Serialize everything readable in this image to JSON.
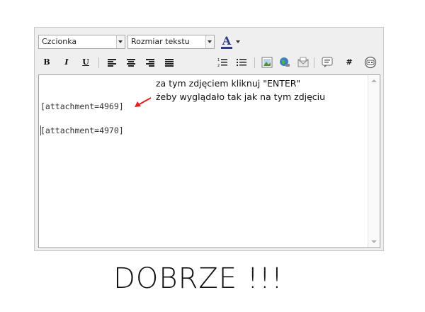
{
  "toolbar": {
    "font_select": "Czcionka",
    "size_select": "Rozmiar tekstu",
    "bold": "B",
    "italic": "I",
    "underline": "U",
    "hash": "#",
    "font_color_icon": "A"
  },
  "editor": {
    "lines": [
      "[attachment=4969]",
      "[attachment=4970]"
    ]
  },
  "annotation": {
    "line1": "za tym zdjęciem kliknuj \"ENTER\"",
    "line2": "żeby wyglądało tak jak na tym zdjęciu",
    "arrow_color": "#e02020"
  },
  "caption": "DOBRZE !!!"
}
